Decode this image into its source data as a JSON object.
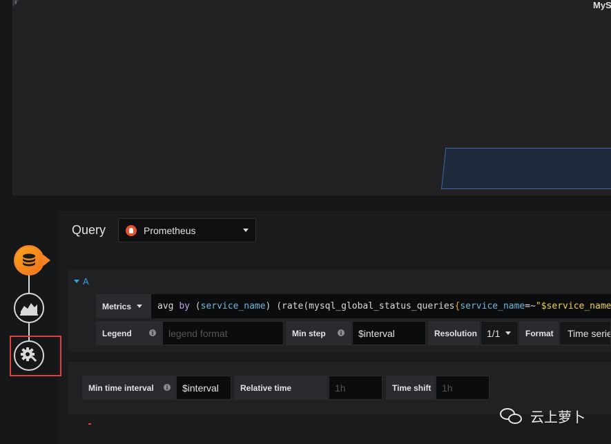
{
  "preview": {
    "title": "MyS",
    "info_marker": "i"
  },
  "query_editor": {
    "heading": "Query",
    "datasource": "Prometheus",
    "query": {
      "ref_id": "A",
      "metrics_label": "Metrics",
      "expression_tokens": [
        {
          "t": "avg ",
          "c": "fn"
        },
        {
          "t": "by",
          "c": "kw"
        },
        {
          "t": " (",
          "c": "op"
        },
        {
          "t": "service_name",
          "c": "lbl"
        },
        {
          "t": ") (",
          "c": "op"
        },
        {
          "t": "rate",
          "c": "fn"
        },
        {
          "t": "(mysql_global_status_queries",
          "c": "fn"
        },
        {
          "t": "{",
          "c": "brace"
        },
        {
          "t": "service_name",
          "c": "lbl"
        },
        {
          "t": "=~",
          "c": "op"
        },
        {
          "t": "\"$service_name\"",
          "c": "str"
        },
        {
          "t": "}",
          "c": "brace"
        },
        {
          "t": "[",
          "c": "op"
        }
      ],
      "legend_label": "Legend",
      "legend_placeholder": "legend format",
      "min_step_label": "Min step",
      "min_step_value": "$interval",
      "resolution_label": "Resolution",
      "resolution_value": "1/1",
      "format_label": "Format",
      "format_value": "Time series"
    },
    "options": {
      "min_interval_label": "Min time interval",
      "min_interval_value": "$interval",
      "relative_time_label": "Relative time",
      "relative_time_placeholder": "1h",
      "time_shift_label": "Time shift",
      "time_shift_placeholder": "1h"
    }
  },
  "sidebar_steps": [
    {
      "name": "queries",
      "icon": "database-icon",
      "active": true
    },
    {
      "name": "visualization",
      "icon": "chart-area-icon",
      "active": false
    },
    {
      "name": "general",
      "icon": "gear-wrench-icon",
      "active": false
    }
  ],
  "info_glyph": "i",
  "watermark": {
    "text": "云上萝卜",
    "icon": "wechat-icon"
  },
  "colors": {
    "accent_orange": "#f3822b",
    "highlight_red": "#e0413b",
    "link_blue": "#33a2e5",
    "prometheus": "#e6522c"
  }
}
